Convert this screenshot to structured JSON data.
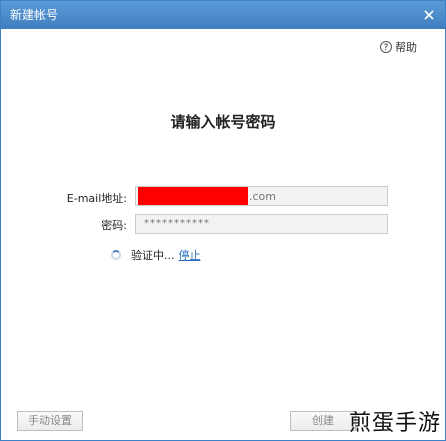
{
  "window": {
    "title": "新建帐号"
  },
  "help": {
    "icon_glyph": "?",
    "label": "帮助"
  },
  "main": {
    "heading": "请输入帐号密码",
    "email": {
      "label": "E-mail地址:",
      "visible_suffix": ".com",
      "redaction_color": "#ff0000"
    },
    "password": {
      "label": "密码:",
      "masked_value": "***********"
    },
    "status": {
      "text": "验证中...",
      "stop_link": "停止"
    }
  },
  "footer": {
    "manual_setup_label": "手动设置",
    "create_label": "创建"
  },
  "watermark": {
    "text": "煎蛋手游"
  },
  "colors": {
    "titlebar": "#4a8bcb",
    "link": "#2b6fc2"
  }
}
